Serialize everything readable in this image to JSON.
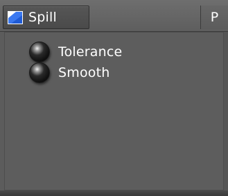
{
  "tabs": {
    "active": {
      "label": "Spill",
      "icon": "spill-icon"
    },
    "other": {
      "label": "P"
    }
  },
  "controls": [
    {
      "label": "Tolerance"
    },
    {
      "label": "Smooth"
    }
  ],
  "colors": {
    "background": "#5c5c5c",
    "text": "#ffffff",
    "knob": "#111111"
  }
}
